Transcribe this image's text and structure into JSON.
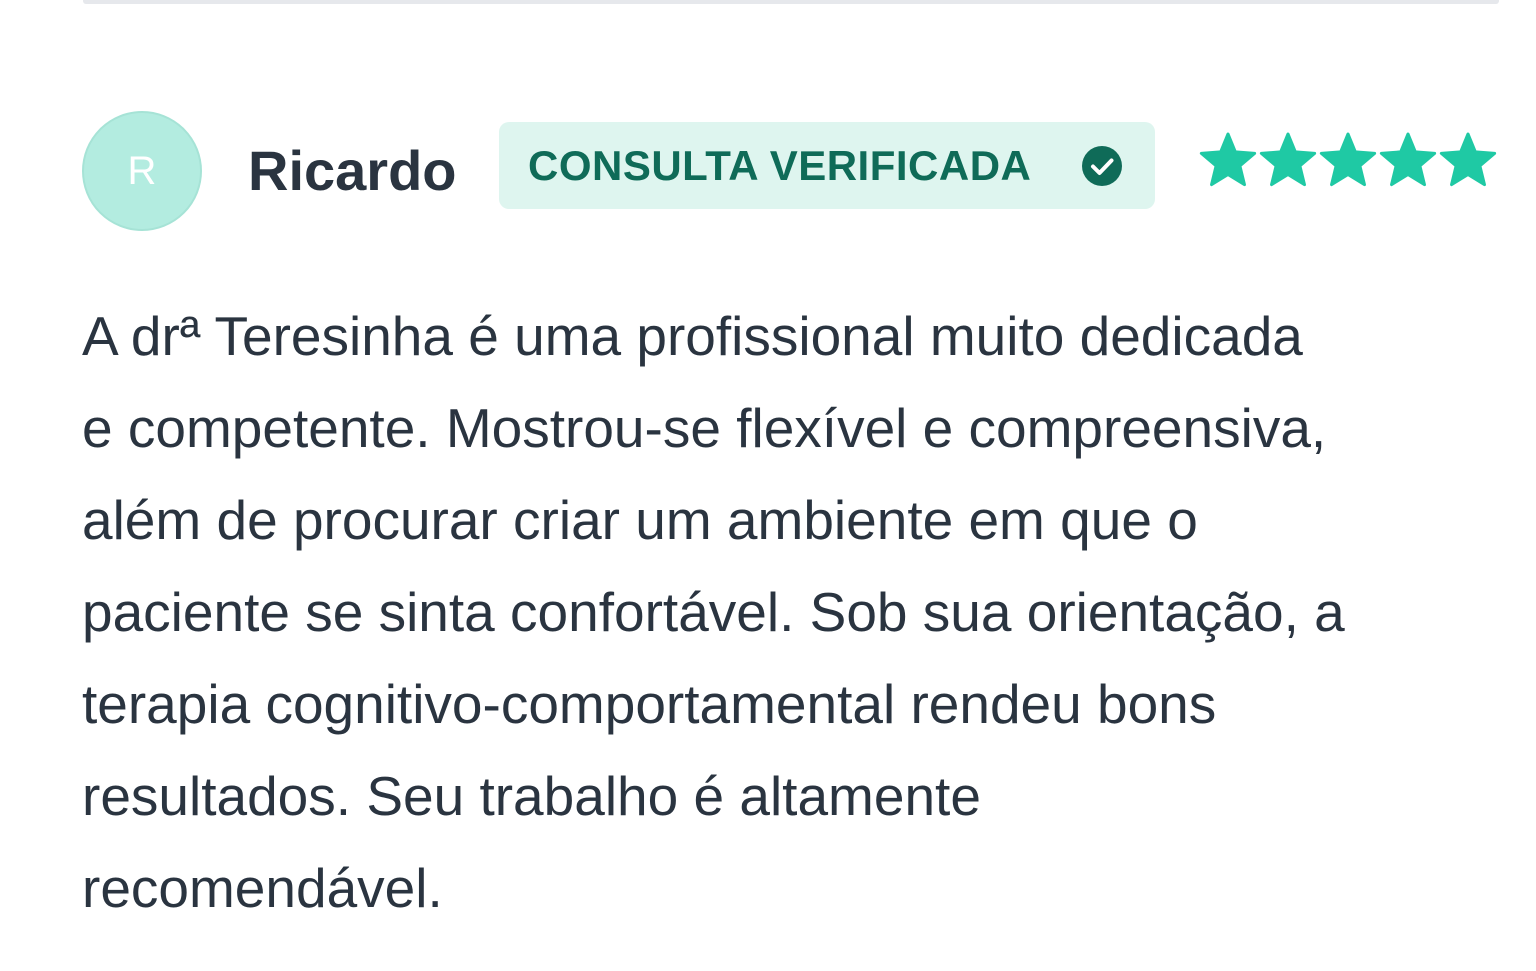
{
  "review": {
    "avatar_initial": "R",
    "reviewer_name": "Ricardo",
    "badge_label": "CONSULTA VERIFICADA",
    "rating": 5,
    "rating_max": 5,
    "text_lines": [
      "A drª Teresinha é uma profissional muito dedicada",
      "e competente. Mostrou-se flexível e compreensiva,",
      "além de procurar criar um ambiente em que o",
      "paciente se sinta confortável. Sob sua orientação, a",
      "terapia cognitivo-comportamental rendeu bons",
      "resultados. Seu trabalho é altamente",
      "recomendável."
    ]
  },
  "colors": {
    "accent": "#1fc9a4",
    "badge_bg": "#def5ef",
    "badge_text": "#0f6b58",
    "avatar_bg": "#b3ece0",
    "text": "#2a3440"
  },
  "icons": {
    "verified": "check-circle-icon",
    "rating": "star-icon"
  }
}
